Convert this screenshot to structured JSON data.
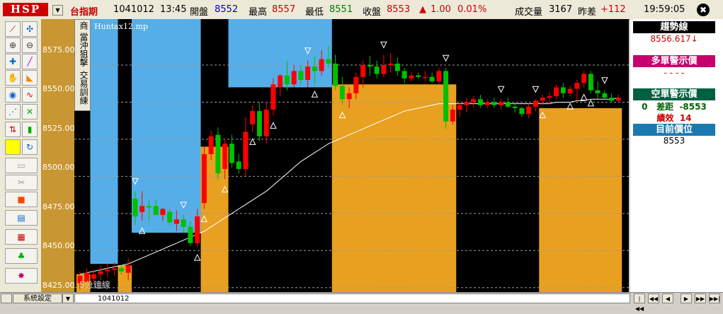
{
  "header": {
    "logo": "HSP",
    "symbol": "台指期",
    "date": "1041012",
    "time": "13:45",
    "open_label": "開盤",
    "open_value": "8552",
    "high_label": "最高",
    "high_value": "8557",
    "low_label": "最低",
    "low_value": "8551",
    "close_label": "收盤",
    "close_value": "8553",
    "change_arrow": "▲",
    "change_value": "1.00",
    "change_pct": "0.01%",
    "volume_label": "成交量",
    "volume_value": "3167",
    "diff_label": "昨差",
    "diff_value": "+112",
    "clock": "19:59:05",
    "close_icon": "✖"
  },
  "toolbar": {
    "icons": [
      "draw-line-icon",
      "cursor-icon",
      "zoom-in-icon",
      "zoom-out-icon",
      "crosshair-icon",
      "pen-icon",
      "hand-icon",
      "shape-icon",
      "color-wheel-icon",
      "wave-icon",
      "trend-icon",
      "cross-icon",
      "arrows-icon",
      "candle-icon",
      "yellow-square-icon",
      "refresh-icon",
      "folder-icon",
      "scissors-icon",
      "stop-icon",
      "chart-icon",
      "grid-icon",
      "users-icon",
      "star-icon"
    ]
  },
  "chart": {
    "file_label": "Huntax12.mp",
    "period_label": "5分鐘線",
    "vertical_tabs": [
      "商",
      "當沖狙擊",
      "交易訓練"
    ],
    "y_ticks": [
      "8575.00",
      "8550.00",
      "8525.00",
      "8500.00",
      "8475.00",
      "8450.00",
      "8425.00"
    ],
    "colors": {
      "bg": "#000000",
      "orange": "#e8a020",
      "blue": "#56aee8",
      "up": "#ff0000",
      "down": "#00c000"
    }
  },
  "chart_data": {
    "type": "candlestick",
    "ylim": [
      8422,
      8606
    ],
    "y_ticks": [
      8425,
      8450,
      8475,
      8500,
      8525,
      8550,
      8575
    ],
    "candles": [
      {
        "o": 8428,
        "h": 8436,
        "l": 8424,
        "c": 8433
      },
      {
        "o": 8429,
        "h": 8438,
        "l": 8427,
        "c": 8435
      },
      {
        "o": 8431,
        "h": 8437,
        "l": 8429,
        "c": 8434
      },
      {
        "o": 8434,
        "h": 8440,
        "l": 8430,
        "c": 8436
      },
      {
        "o": 8436,
        "h": 8441,
        "l": 8432,
        "c": 8437
      },
      {
        "o": 8437,
        "h": 8442,
        "l": 8433,
        "c": 8438
      },
      {
        "o": 8438,
        "h": 8440,
        "l": 8434,
        "c": 8436
      },
      {
        "o": 8435,
        "h": 8445,
        "l": 8430,
        "c": 8440
      },
      {
        "o": 8485,
        "h": 8490,
        "l": 8467,
        "c": 8473
      },
      {
        "o": 8476,
        "h": 8490,
        "l": 8470,
        "c": 8480
      },
      {
        "o": 8480,
        "h": 8484,
        "l": 8470,
        "c": 8479
      },
      {
        "o": 8480,
        "h": 8484,
        "l": 8474,
        "c": 8474
      },
      {
        "o": 8474,
        "h": 8479,
        "l": 8470,
        "c": 8478
      },
      {
        "o": 8476,
        "h": 8478,
        "l": 8467,
        "c": 8469
      },
      {
        "o": 8468,
        "h": 8477,
        "l": 8463,
        "c": 8471
      },
      {
        "o": 8471,
        "h": 8474,
        "l": 8462,
        "c": 8466
      },
      {
        "o": 8466,
        "h": 8470,
        "l": 8453,
        "c": 8455
      },
      {
        "o": 8455,
        "h": 8478,
        "l": 8452,
        "c": 8473
      },
      {
        "o": 8482,
        "h": 8520,
        "l": 8478,
        "c": 8515
      },
      {
        "o": 8515,
        "h": 8531,
        "l": 8511,
        "c": 8527
      },
      {
        "o": 8528,
        "h": 8533,
        "l": 8498,
        "c": 8502
      },
      {
        "o": 8505,
        "h": 8525,
        "l": 8498,
        "c": 8522
      },
      {
        "o": 8522,
        "h": 8528,
        "l": 8506,
        "c": 8509
      },
      {
        "o": 8510,
        "h": 8515,
        "l": 8502,
        "c": 8505
      },
      {
        "o": 8505,
        "h": 8540,
        "l": 8500,
        "c": 8530
      },
      {
        "o": 8535,
        "h": 8548,
        "l": 8530,
        "c": 8544
      },
      {
        "o": 8544,
        "h": 8550,
        "l": 8524,
        "c": 8527
      },
      {
        "o": 8527,
        "h": 8550,
        "l": 8522,
        "c": 8545
      },
      {
        "o": 8545,
        "h": 8566,
        "l": 8541,
        "c": 8562
      },
      {
        "o": 8560,
        "h": 8569,
        "l": 8554,
        "c": 8568
      },
      {
        "o": 8568,
        "h": 8578,
        "l": 8558,
        "c": 8562
      },
      {
        "o": 8562,
        "h": 8575,
        "l": 8560,
        "c": 8571
      },
      {
        "o": 8571,
        "h": 8575,
        "l": 8562,
        "c": 8565
      },
      {
        "o": 8565,
        "h": 8578,
        "l": 8560,
        "c": 8574
      },
      {
        "o": 8574,
        "h": 8581,
        "l": 8562,
        "c": 8571
      },
      {
        "o": 8571,
        "h": 8585,
        "l": 8568,
        "c": 8579
      },
      {
        "o": 8579,
        "h": 8588,
        "l": 8573,
        "c": 8576
      },
      {
        "o": 8576,
        "h": 8582,
        "l": 8558,
        "c": 8561
      },
      {
        "o": 8561,
        "h": 8567,
        "l": 8548,
        "c": 8552
      },
      {
        "o": 8552,
        "h": 8560,
        "l": 8546,
        "c": 8556
      },
      {
        "o": 8556,
        "h": 8570,
        "l": 8552,
        "c": 8567
      },
      {
        "o": 8567,
        "h": 8578,
        "l": 8560,
        "c": 8575
      },
      {
        "o": 8575,
        "h": 8581,
        "l": 8568,
        "c": 8574
      },
      {
        "o": 8574,
        "h": 8578,
        "l": 8566,
        "c": 8569
      },
      {
        "o": 8569,
        "h": 8582,
        "l": 8567,
        "c": 8575
      },
      {
        "o": 8575,
        "h": 8583,
        "l": 8570,
        "c": 8576
      },
      {
        "o": 8576,
        "h": 8580,
        "l": 8568,
        "c": 8571
      },
      {
        "o": 8571,
        "h": 8573,
        "l": 8563,
        "c": 8566
      },
      {
        "o": 8566,
        "h": 8570,
        "l": 8564,
        "c": 8568
      },
      {
        "o": 8568,
        "h": 8570,
        "l": 8566,
        "c": 8567
      },
      {
        "o": 8567,
        "h": 8571,
        "l": 8564,
        "c": 8567
      },
      {
        "o": 8567,
        "h": 8570,
        "l": 8563,
        "c": 8564
      },
      {
        "o": 8564,
        "h": 8573,
        "l": 8562,
        "c": 8571
      },
      {
        "o": 8571,
        "h": 8573,
        "l": 8532,
        "c": 8537
      },
      {
        "o": 8537,
        "h": 8548,
        "l": 8535,
        "c": 8545
      },
      {
        "o": 8545,
        "h": 8551,
        "l": 8540,
        "c": 8548
      },
      {
        "o": 8548,
        "h": 8553,
        "l": 8543,
        "c": 8550
      },
      {
        "o": 8550,
        "h": 8554,
        "l": 8546,
        "c": 8552
      },
      {
        "o": 8552,
        "h": 8555,
        "l": 8546,
        "c": 8548
      },
      {
        "o": 8548,
        "h": 8552,
        "l": 8546,
        "c": 8550
      },
      {
        "o": 8550,
        "h": 8553,
        "l": 8546,
        "c": 8548
      },
      {
        "o": 8548,
        "h": 8552,
        "l": 8545,
        "c": 8550
      },
      {
        "o": 8550,
        "h": 8553,
        "l": 8546,
        "c": 8547
      },
      {
        "o": 8547,
        "h": 8550,
        "l": 8543,
        "c": 8546
      },
      {
        "o": 8546,
        "h": 8547,
        "l": 8540,
        "c": 8542
      },
      {
        "o": 8542,
        "h": 8549,
        "l": 8539,
        "c": 8547
      },
      {
        "o": 8547,
        "h": 8552,
        "l": 8544,
        "c": 8551
      },
      {
        "o": 8551,
        "h": 8555,
        "l": 8548,
        "c": 8553
      },
      {
        "o": 8553,
        "h": 8557,
        "l": 8549,
        "c": 8554
      },
      {
        "o": 8554,
        "h": 8562,
        "l": 8552,
        "c": 8560
      },
      {
        "o": 8560,
        "h": 8563,
        "l": 8553,
        "c": 8556
      },
      {
        "o": 8556,
        "h": 8561,
        "l": 8554,
        "c": 8559
      },
      {
        "o": 8559,
        "h": 8565,
        "l": 8551,
        "c": 8563
      },
      {
        "o": 8563,
        "h": 8571,
        "l": 8560,
        "c": 8569
      },
      {
        "o": 8569,
        "h": 8571,
        "l": 8556,
        "c": 8558
      },
      {
        "o": 8558,
        "h": 8564,
        "l": 8552,
        "c": 8556
      },
      {
        "o": 8556,
        "h": 8558,
        "l": 8552,
        "c": 8553
      },
      {
        "o": 8553,
        "h": 8556,
        "l": 8550,
        "c": 8551
      },
      {
        "o": 8551,
        "h": 8555,
        "l": 8550,
        "c": 8553
      }
    ],
    "ma": [
      8434,
      8435,
      8436,
      8437,
      8438,
      8439,
      8440,
      8441,
      8443,
      8445,
      8447,
      8449,
      8451,
      8453,
      8455,
      8457,
      8459,
      8461,
      8463,
      8466,
      8469,
      8472,
      8475,
      8478,
      8481,
      8484,
      8487,
      8490,
      8494,
      8498,
      8502,
      8506,
      8510,
      8513,
      8516,
      8519,
      8522,
      8524,
      8526,
      8528,
      8530,
      8532,
      8534,
      8536,
      8538,
      8540,
      8542,
      8544,
      8545,
      8546,
      8547,
      8548,
      8549,
      8549,
      8549,
      8549,
      8549,
      8549,
      8549,
      8549,
      8549,
      8549,
      8549,
      8549,
      8549,
      8549,
      8549,
      8549,
      8549,
      8550,
      8550,
      8550,
      8551,
      8551,
      8552,
      8552,
      8552,
      8552,
      8553
    ],
    "regions": [
      {
        "from": 0,
        "to": 1,
        "type": "orange",
        "level": 8434
      },
      {
        "from": 2,
        "to": 5,
        "type": "blue",
        "level": 8441
      },
      {
        "from": 6,
        "to": 7,
        "type": "orange",
        "level": 8440
      },
      {
        "from": 8,
        "to": 17,
        "type": "blue",
        "level": 8462
      },
      {
        "from": 18,
        "to": 21,
        "type": "orange",
        "level": 8520
      },
      {
        "from": 22,
        "to": 36,
        "type": "blue",
        "level": 8560
      },
      {
        "from": 37,
        "to": 54,
        "type": "orange",
        "level": 8562
      },
      {
        "from": 55,
        "to": 66,
        "type": "black",
        "level": 8550
      },
      {
        "from": 67,
        "to": 78,
        "type": "orange",
        "level": 8546
      }
    ],
    "markers": [
      {
        "i": 8,
        "t": "down"
      },
      {
        "i": 9,
        "t": "up"
      },
      {
        "i": 15,
        "t": "down"
      },
      {
        "i": 17,
        "t": "up"
      },
      {
        "i": 18,
        "t": "up"
      },
      {
        "i": 21,
        "t": "up"
      },
      {
        "i": 25,
        "t": "up"
      },
      {
        "i": 28,
        "t": "up"
      },
      {
        "i": 33,
        "t": "down"
      },
      {
        "i": 34,
        "t": "up"
      },
      {
        "i": 38,
        "t": "up"
      },
      {
        "i": 44,
        "t": "down"
      },
      {
        "i": 53,
        "t": "down"
      },
      {
        "i": 61,
        "t": "down"
      },
      {
        "i": 66,
        "t": "down"
      },
      {
        "i": 67,
        "t": "up"
      },
      {
        "i": 71,
        "t": "up"
      },
      {
        "i": 73,
        "t": "up"
      },
      {
        "i": 74,
        "t": "up"
      },
      {
        "i": 76,
        "t": "down"
      }
    ]
  },
  "right_panel": {
    "trend_label": "趨勢線",
    "trend_value": "8556.617↓",
    "long_label": "多單警示價",
    "long_value": "- - - -",
    "short_label": "空單警示價",
    "short_line_prefix": "0",
    "short_diff_label": "差距",
    "short_diff_value": "-8553",
    "perf_label": "績效",
    "perf_value": "14",
    "current_label": "目前價位",
    "current_value": "8553"
  },
  "bottom": {
    "settings_label": "系統設定",
    "dropdown": "▼",
    "date_field": "1041012",
    "nav_labels": [
      "|◀◀",
      "◀◀",
      "◀",
      "▶",
      "▶▶",
      "▶▶|"
    ]
  }
}
